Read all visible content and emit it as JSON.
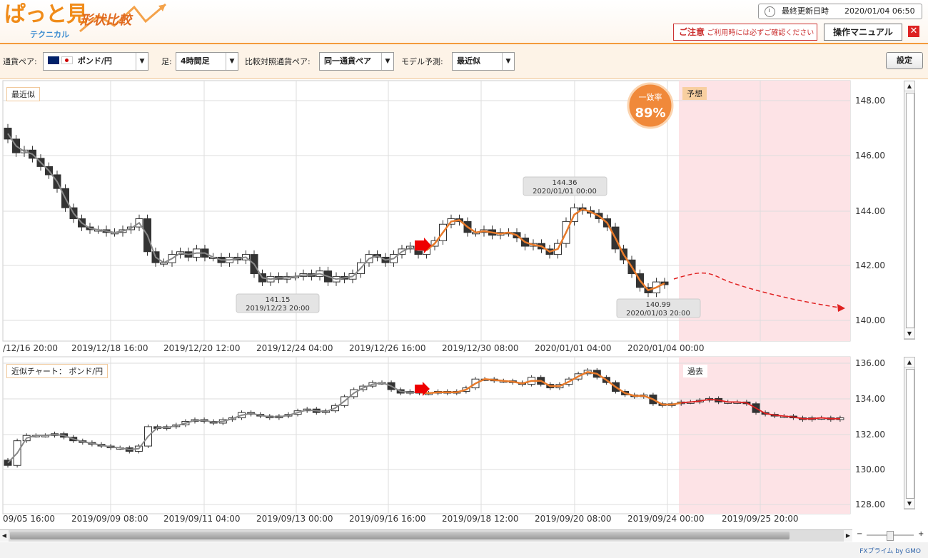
{
  "app": {
    "logo_main": "ぱっと見",
    "logo_sub": "テクニカル",
    "logo_title": "形状比較",
    "update_label": "最終更新日時",
    "update_value": "2020/01/04 06:50",
    "caution_title": "ご注意",
    "caution_text": "ご利用時には必ずご確認ください",
    "manual_label": "操作マニュアル",
    "close_label": "✕"
  },
  "toolbar": {
    "pair_label": "通貨ペア:",
    "pair_value": "ポンド/円",
    "bar_label": "足:",
    "bar_value": "4時間足",
    "compare_label": "比較対照通貨ペア:",
    "compare_value": "同一通貨ペア",
    "model_label": "モデル予測:",
    "model_value": "最近似",
    "settings_label": "設定"
  },
  "top_chart": {
    "tag": "最近似",
    "match_label": "一致率",
    "match_value": "89%",
    "forecast_tag": "予想",
    "ylabels": [
      "148.00",
      "146.00",
      "144.00",
      "142.00",
      "140.00"
    ],
    "xlabels": [
      "/12/16 20:00",
      "2019/12/18 16:00",
      "2019/12/20 12:00",
      "2019/12/24 04:00",
      "2019/12/26 16:00",
      "2019/12/30 08:00",
      "2020/01/01 04:00",
      "2020/01/04 00:00"
    ],
    "callouts": [
      {
        "value": "141.15",
        "date": "2019/12/23 20:00"
      },
      {
        "value": "144.36",
        "date": "2020/01/01 00:00"
      },
      {
        "value": "140.99",
        "date": "2020/01/03 20:00"
      }
    ]
  },
  "bottom_chart": {
    "tag": "近似チャート： ポンド/円",
    "past_tag": "過去",
    "ylabels": [
      "136.00",
      "134.00",
      "132.00",
      "130.00",
      "128.00"
    ],
    "xlabels": [
      "09/05 16:00",
      "2019/09/09 08:00",
      "2019/09/11 04:00",
      "2019/09/13 00:00",
      "2019/09/16 16:00",
      "2019/09/18 12:00",
      "2019/09/20 08:00",
      "2019/09/24 00:00",
      "2019/09/25 20:00"
    ]
  },
  "footer": {
    "brand": "FXプライム by GMO"
  },
  "colors": {
    "accent": "#f08c1a",
    "forecast_bg": "#fde3e6",
    "fit_orange": "#e87a2a",
    "forecast_red": "#e02020",
    "candle_dark": "#333333"
  }
}
